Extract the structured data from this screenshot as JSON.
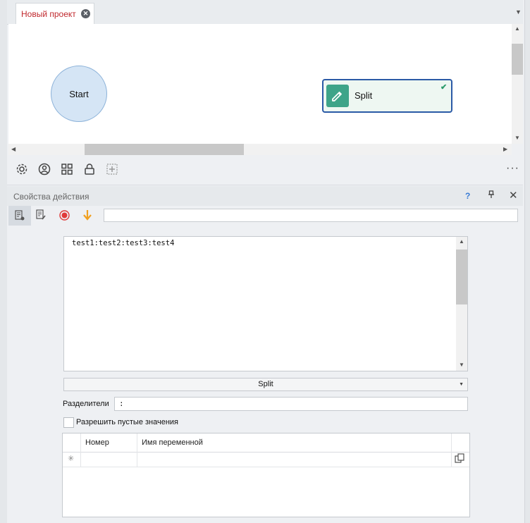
{
  "project_tab": {
    "label": "Новый проект"
  },
  "canvas": {
    "nodes": [
      {
        "label": "Start",
        "shape": "circle"
      },
      {
        "label": "Split",
        "shape": "action",
        "status": "ok"
      }
    ]
  },
  "canvas_toolbar": {
    "icons": [
      "settings-icon",
      "user-icon",
      "grid-icon",
      "lock-icon",
      "add-icon"
    ],
    "more": "···"
  },
  "panel": {
    "title": "Свойства действия",
    "help": "?",
    "toolbar_input_value": ""
  },
  "action": {
    "input_text": "test1:test2:test3:test4",
    "operation": "Split",
    "delimiters_label": "Разделители",
    "delimiters_value": ":",
    "allow_empty_label": "Разрешить пустые значения",
    "allow_empty_checked": false
  },
  "result_grid": {
    "columns": [
      "Номер",
      "Имя переменной"
    ],
    "rows": [],
    "new_row_marker": "✳"
  },
  "colors": {
    "tab_text": "#c0282d",
    "action_node_border": "#2b5aa6",
    "action_icon_bg": "#3ea489",
    "start_node_fill": "#d5e5f5"
  }
}
